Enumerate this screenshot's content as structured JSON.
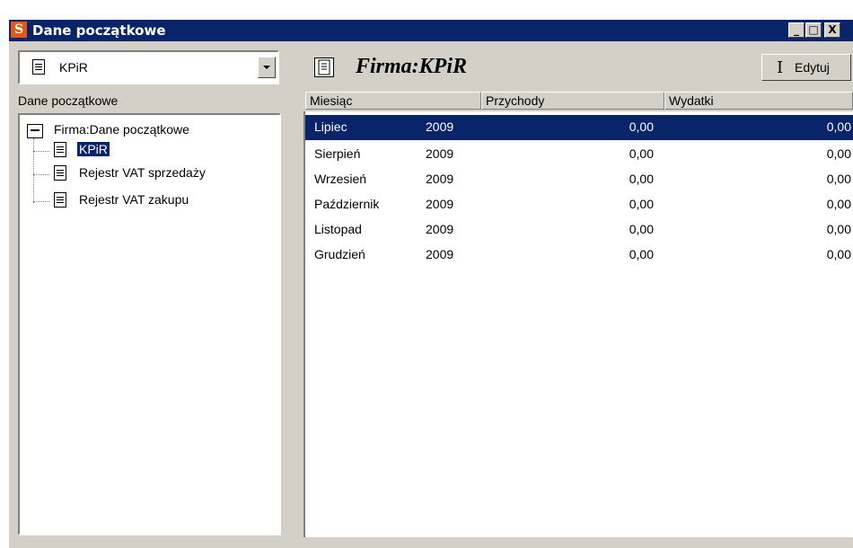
{
  "window": {
    "title": "Dane początkowe",
    "app_icon_letter": "S",
    "controls": [
      "_",
      "□",
      "X"
    ]
  },
  "left_panel": {
    "combo_value": "KPiR",
    "label": "Dane początkowe",
    "tree": {
      "root": "Firma:Dane początkowe",
      "children": [
        "KPiR",
        "Rejestr VAT sprzedaży",
        "Rejestr VAT zakupu"
      ],
      "selected": "KPiR"
    }
  },
  "right_panel": {
    "title": "Firma:KPiR",
    "edit_label": "Edytuj",
    "columns": [
      "Miesiąc",
      "Przychody",
      "Wydatki"
    ],
    "rows": [
      {
        "month": "Lipiec",
        "year": "2009",
        "income": "0,00",
        "expenses": "0,00"
      },
      {
        "month": "Sierpień",
        "year": "2009",
        "income": "0,00",
        "expenses": "0,00"
      },
      {
        "month": "Wrzesień",
        "year": "2009",
        "income": "0,00",
        "expenses": "0,00"
      },
      {
        "month": "Październik",
        "year": "2009",
        "income": "0,00",
        "expenses": "0,00"
      },
      {
        "month": "Listopad",
        "year": "2009",
        "income": "0,00",
        "expenses": "0,00"
      },
      {
        "month": "Grudzień",
        "year": "2009",
        "income": "0,00",
        "expenses": "0,00"
      }
    ],
    "selected_row": 0
  },
  "colors": {
    "titlebar": "#0a246a",
    "face": "#d4d0c8",
    "selection": "#0a246a",
    "app_icon": "#e05a1a"
  }
}
